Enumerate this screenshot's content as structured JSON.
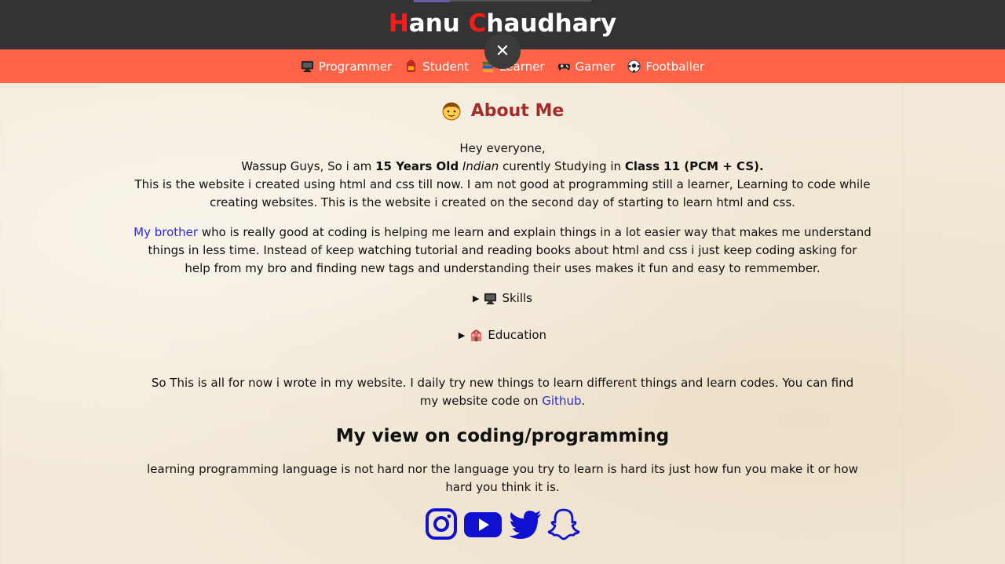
{
  "header": {
    "title_first_cap": "H",
    "title_first_rest": "anu ",
    "title_second_cap": "C",
    "title_second_rest": "haudhary"
  },
  "nav": {
    "items": [
      {
        "label": "Programmer",
        "icon": "computer-icon"
      },
      {
        "label": "Student",
        "icon": "backpack-icon"
      },
      {
        "label": "Learner",
        "icon": "books-icon"
      },
      {
        "label": "Gamer",
        "icon": "gamepad-icon"
      },
      {
        "label": "Footballer",
        "icon": "soccer-ball-icon"
      }
    ],
    "close_glyph": "✕"
  },
  "about": {
    "heading": "About Me",
    "greeting": "Hey everyone,",
    "line2_a": "Wassup Guys, So i am ",
    "line2_age": "15 Years Old",
    "line2_b": " ",
    "line2_nationality": "Indian",
    "line2_c": " curently Studying in ",
    "line2_class": "Class 11 (PCM + CS).",
    "line3": "This is the website i created using html and css till now. I am not good at programming still a learner, Learning to code while creating websites. This is the website i created on the second day of starting to learn html and css.",
    "brother_link": "My brother",
    "brother_text": " who is really good at coding is helping me learn and explain things in a lot easier way that makes me understand things in less time. Instead of keep watching tutorial and reading books about html and css i just keep coding asking for help from my bro and finding new tags and understanding their uses makes it fun and easy to remmember."
  },
  "details": {
    "skills_label": "Skills",
    "education_label": "Education"
  },
  "outro": {
    "text_a": "So This is all for now i wrote in my website. I daily try new things to learn different things and learn codes. You can find my website code on ",
    "github_link": "Github",
    "text_b": "."
  },
  "view": {
    "heading": "My view on coding/programming",
    "text": "learning programming language is not hard nor the language you try to learn is hard its just how fun you make it or how hard you think it is."
  },
  "socials": [
    "instagram-icon",
    "youtube-icon",
    "twitter-icon",
    "snapchat-icon"
  ],
  "colors": {
    "topbar": "#333333",
    "navbar": "#ff6347",
    "title_accent": "#ff1a1a",
    "heading_accent": "#a52a2a",
    "link": "#2a2ad0",
    "social_blue": "#1010d0"
  }
}
